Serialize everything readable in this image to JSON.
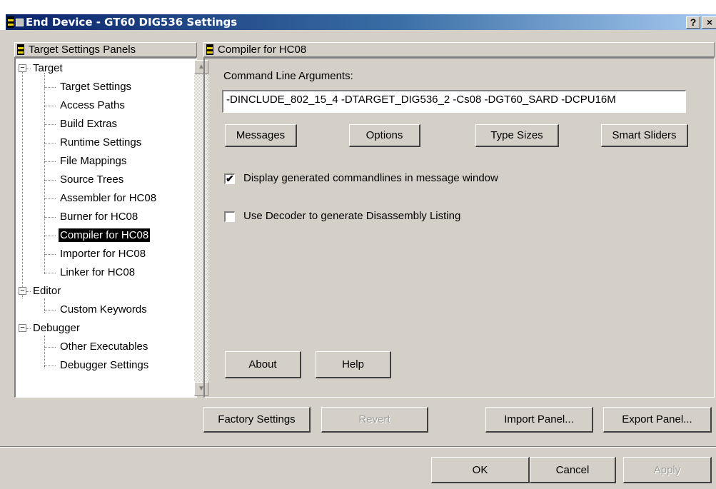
{
  "window": {
    "title": "End Device - GT60 DIG536 Settings",
    "help_button": "?",
    "close_button": "×"
  },
  "left_panel": {
    "header": "Target Settings Panels",
    "tree": [
      {
        "label": "Target",
        "level": 0,
        "expander": "−"
      },
      {
        "label": "Target Settings",
        "level": 1
      },
      {
        "label": "Access Paths",
        "level": 1
      },
      {
        "label": "Build Extras",
        "level": 1
      },
      {
        "label": "Runtime Settings",
        "level": 1
      },
      {
        "label": "File Mappings",
        "level": 1
      },
      {
        "label": "Source Trees",
        "level": 1
      },
      {
        "label": "Assembler for HC08",
        "level": 1
      },
      {
        "label": "Burner for HC08",
        "level": 1
      },
      {
        "label": "Compiler for HC08",
        "level": 1,
        "selected": true
      },
      {
        "label": "Importer for HC08",
        "level": 1
      },
      {
        "label": "Linker for HC08",
        "level": 1
      },
      {
        "label": "Editor",
        "level": 0,
        "expander": "−"
      },
      {
        "label": "Custom Keywords",
        "level": 1
      },
      {
        "label": "Debugger",
        "level": 0,
        "expander": "−"
      },
      {
        "label": "Other Executables",
        "level": 1
      },
      {
        "label": "Debugger Settings",
        "level": 1
      }
    ]
  },
  "right_panel": {
    "header": "Compiler for HC08",
    "command_line_label": "Command Line Arguments:",
    "command_line_value": "-DINCLUDE_802_15_4 -DTARGET_DIG536_2 -Cs08 -DGT60_SARD -DCPU16M",
    "buttons": {
      "messages": "Messages",
      "options": "Options",
      "type_sizes": "Type Sizes",
      "smart_sliders": "Smart Sliders",
      "about": "About",
      "help": "Help"
    },
    "checkboxes": {
      "display_commandlines": {
        "label": "Display generated commandlines in message window",
        "checked": true,
        "mark": "✔"
      },
      "use_decoder": {
        "label": "Use Decoder to generate Disassembly Listing",
        "checked": false,
        "mark": ""
      }
    }
  },
  "panel_buttons": {
    "factory_settings": "Factory Settings",
    "revert": "Revert",
    "import_panel": "Import Panel...",
    "export_panel": "Export Panel..."
  },
  "dialog_buttons": {
    "ok": "OK",
    "cancel": "Cancel",
    "apply": "Apply"
  }
}
